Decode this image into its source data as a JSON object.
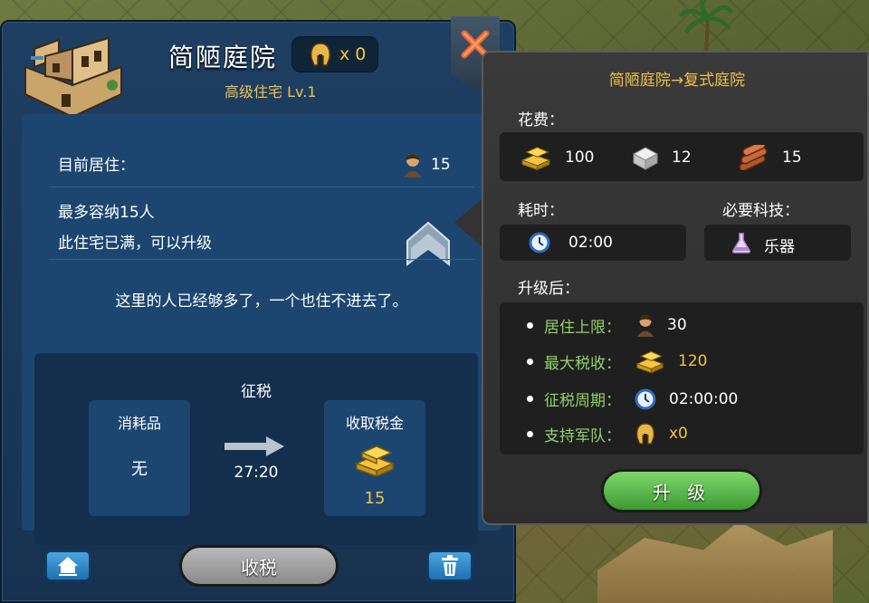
{
  "building": {
    "name": "简陋庭院",
    "troops_label": "x 0",
    "subtitle": "高级住宅 Lv.1"
  },
  "residence": {
    "current_label": "目前居住：",
    "current_count": "15",
    "capacity_text": "最多容纳15人",
    "status_text": "此住宅已满，可以升级",
    "crowded_message": "这里的人已经够多了，一个也住不进去了。"
  },
  "tax": {
    "title": "征税",
    "consume_label": "消耗品",
    "consume_value": "无",
    "time": "27:20",
    "collect_label": "收取税金",
    "collect_amount": "15"
  },
  "buttons": {
    "collect_tax": "收税",
    "upgrade": "升 级"
  },
  "upgrade": {
    "title": "简陋庭院→复式庭院",
    "cost_label": "花费：",
    "costs": [
      {
        "icon": "gold-icon",
        "value": "100"
      },
      {
        "icon": "stone-icon",
        "value": "12"
      },
      {
        "icon": "wood-icon",
        "value": "15"
      }
    ],
    "time_label": "耗时：",
    "time_value": "02:00",
    "tech_label": "必要科技：",
    "tech_value": "乐器",
    "after_label": "升级后：",
    "after": [
      {
        "label": "居住上限：",
        "icon": "citizen-icon",
        "value": "30",
        "value_color": "#ffffff"
      },
      {
        "label": "最大税收：",
        "icon": "gold-icon",
        "value": "120",
        "value_color": "#f2c14b"
      },
      {
        "label": "征税周期：",
        "icon": "clock-icon",
        "value": "02:00:00",
        "value_color": "#ffffff"
      },
      {
        "label": "支持军队：",
        "icon": "helmet-icon",
        "value": "x0",
        "value_color": "#f2c14b"
      }
    ]
  },
  "colors": {
    "panel_blue": "#1e3f63",
    "gold_text": "#f2c14b",
    "green_label": "#8fd36b",
    "upgrade_green": "#3c9a32"
  }
}
